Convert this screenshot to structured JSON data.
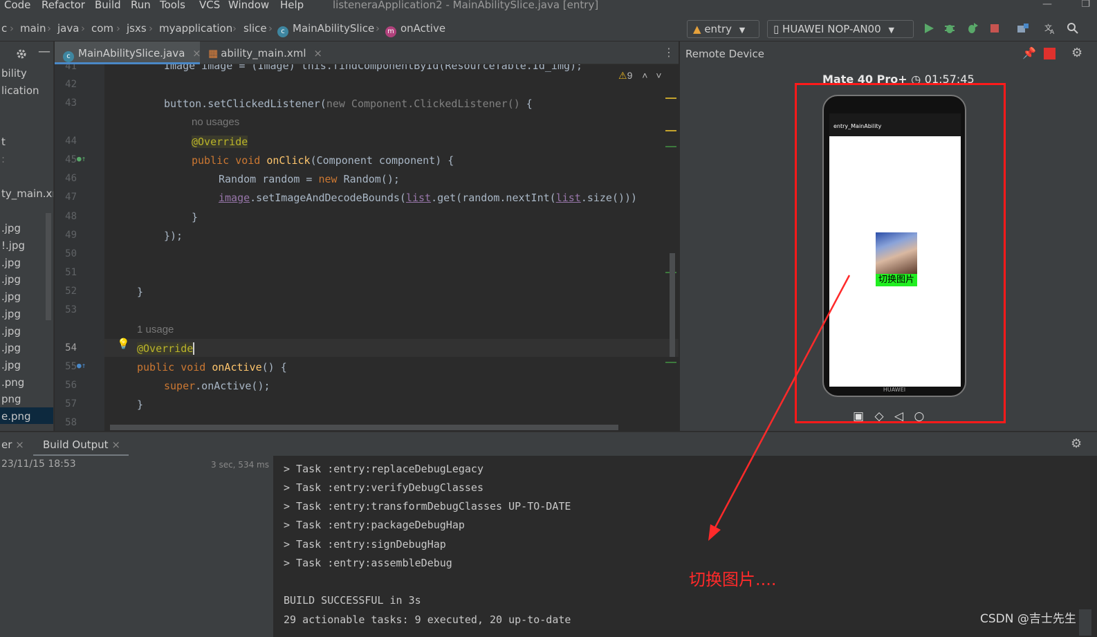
{
  "menu": {
    "items": [
      "Code",
      "Refactor",
      "Build",
      "Run",
      "Tools",
      "VCS",
      "Window",
      "Help"
    ],
    "window_title": "listeneraApplication2 - MainAbilitySlice.java [entry]"
  },
  "breadcrumbs": [
    "c",
    "main",
    "java",
    "com",
    "jsxs",
    "myapplication",
    "slice",
    "MainAbilitySlice",
    "onActive"
  ],
  "toolbar": {
    "run_config": "entry",
    "device": "HUAWEI NOP-AN00",
    "colors": {
      "run": "#59a869",
      "stop": "#c75450",
      "accent": "#4a88c7"
    }
  },
  "project": {
    "items": [
      "bility",
      "lication",
      "t",
      ":",
      "ty_main.xm",
      ".jpg",
      "!.jpg",
      ".jpg",
      ".jpg",
      ".jpg",
      ".jpg",
      ".jpg",
      ".jpg",
      ".jpg",
      ".png",
      "png",
      "e.png"
    ]
  },
  "editor": {
    "tabs": [
      "MainAbilitySlice.java",
      "ability_main.xml"
    ],
    "warning_count": "9",
    "line_numbers": [
      "41",
      "42",
      "43",
      "44",
      "45",
      "46",
      "47",
      "48",
      "49",
      "50",
      "51",
      "52",
      "53",
      "54",
      "55",
      "56",
      "57",
      "58"
    ],
    "hints": {
      "no_usages": "no usages",
      "one_usage": "1 usage"
    },
    "code": {
      "l41": "Image image = (Image) this.findComponentById(ResourceTable.Id_img);",
      "l43_a": "button.setClickedListener(",
      "l43_b": "new Component.ClickedListener()",
      "l43_c": " {",
      "l44": "@Override",
      "l45_a": "public void ",
      "l45_b": "onClick",
      "l45_c": "(Component component) {",
      "l46_a": "Random random = ",
      "l46_b": "new",
      "l46_c": " Random();",
      "l47_a": "image",
      "l47_b": ".setImageAndDecodeBounds(",
      "l47_c": "list",
      "l47_d": ".get(random.nextInt(",
      "l47_e": "list",
      "l47_f": ".size()))",
      "l48": "}",
      "l49_a": "});",
      "l52": "}",
      "l54": "@Override",
      "l55_a": "public void ",
      "l55_b": "onActive",
      "l55_c": "() {",
      "l56_a": "super",
      "l56_b": ".onActive();",
      "l57": "}"
    }
  },
  "remote_device": {
    "title": "Remote Device",
    "device_name": "Mate 40 Pro+",
    "clock": "01:57:45",
    "app_title": "entry_MainAbility",
    "button_label": "切换图片",
    "brand": "HUAWEI"
  },
  "bottom": {
    "tabs": [
      "er",
      "Build Output"
    ],
    "build_time": "23/11/15 18:53",
    "duration": "3 sec, 534 ms",
    "console_lines": [
      "> Task :entry:replaceDebugLegacy",
      "> Task :entry:verifyDebugClasses",
      "> Task :entry:transformDebugClasses UP-TO-DATE",
      "> Task :entry:packageDebugHap",
      "> Task :entry:signDebugHap",
      "> Task :entry:assembleDebug",
      "",
      "BUILD SUCCESSFUL in 3s",
      "29 actionable tasks: 9 executed, 20 up-to-date"
    ]
  },
  "annotation": "切换图片....",
  "watermark": "CSDN @吉士先生"
}
